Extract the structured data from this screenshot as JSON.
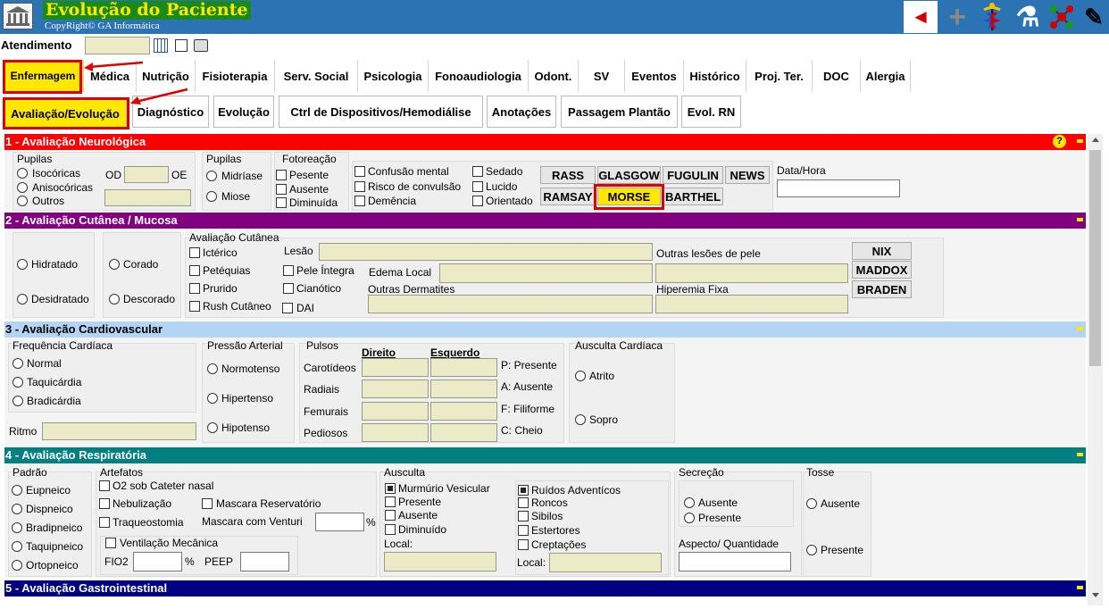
{
  "app": {
    "title": "Evolução do Paciente",
    "copyright": "CopyRight© GA Informática"
  },
  "toolbar": {
    "icons": [
      "back-arrow-icon",
      "plus-icon",
      "caduceus-icon",
      "lab-flask-icon",
      "molecule-icon",
      "pen-tools-icon"
    ],
    "back_glyph": "◄",
    "plus_glyph": "+",
    "flask_glyph": "⚗",
    "molecule_glyph": "✣",
    "tools_glyph": "✎"
  },
  "atendimento": {
    "label": "Atendimento",
    "value": ""
  },
  "tabs": [
    "Enfermagem",
    "Médica",
    "Nutrição",
    "Fisioterapia",
    "Serv. Social",
    "Psicologia",
    "Fonoaudiologia",
    "Odont.",
    "SV",
    "Eventos",
    "Histórico",
    "Proj. Ter.",
    "DOC",
    "Alergia"
  ],
  "subtabs": [
    "Avaliação/Evolução",
    "Diagnóstico",
    "Evolução",
    "Ctrl de Dispositivos/Hemodiálise",
    "Anotações",
    "Passagem Plantão",
    "Evol. RN"
  ],
  "colors": {
    "header": "#2b73b3",
    "sec1": "#ff0000",
    "sec2": "#800080",
    "sec3": "#b3d4f3",
    "sec4": "#008080",
    "sec5": "#000080",
    "field": "#ecebc8",
    "highlight": "#ffe800"
  },
  "s1": {
    "title": "1 - Avaliação Neurológica",
    "help": "?",
    "pupilas_a": "Pupilas",
    "isocoricas": "Isocóricas",
    "anisocoricas": "Anisocóricas",
    "outros": "Outros",
    "od": "OD",
    "oe": "OE",
    "pupilas_b": "Pupilas",
    "midriase": "Midríase",
    "miose": "Miose",
    "fotoreacao": "Fotoreação",
    "presente": "Pesente",
    "ausente": "Ausente",
    "diminuida": "Diminuída",
    "confusao": "Confusão mental",
    "risco": "Risco de convulsão",
    "demencia": "Demência",
    "sedado": "Sedado",
    "lucido": "Lucido",
    "orientado": "Orientado",
    "scales": [
      "RASS",
      "GLASGOW",
      "FUGULIN",
      "NEWS",
      "RAMSAY",
      "MORSE",
      "BARTHEL"
    ],
    "datahora": "Data/Hora"
  },
  "s2": {
    "title": "2 - Avaliação Cutânea / Mucosa",
    "hidratado": "Hidratado",
    "desidratado": "Desidratado",
    "corado": "Corado",
    "descorado": "Descorado",
    "aval": "Avaliação Cutânea",
    "icterico": "Ictérico",
    "peteq": "Petéquias",
    "prurido": "Prurido",
    "rush": "Rush Cutâneo",
    "pele": "Pele Íntegra",
    "cian": "Cianótico",
    "dai": "DAI",
    "lesao": "Lesão",
    "edema": "Edema Local",
    "outras_derm": "Outras Dermatites",
    "outras_lesoes": "Outras lesões de pele",
    "hiperemia": "Hiperemia Fixa",
    "scales": [
      "NIX",
      "MADDOX",
      "BRADEN"
    ]
  },
  "s3": {
    "title": "3 - Avaliação Cardiovascular",
    "freq": "Frequência Cardíaca",
    "normal": "Normal",
    "taqui": "Taquicárdia",
    "bradi": "Bradicárdia",
    "ritmo": "Ritmo",
    "pressao": "Pressão Arterial",
    "normo": "Normotenso",
    "hiper": "Hipertenso",
    "hipo": "Hipotenso",
    "pulsos": "Pulsos",
    "direito": "Direito",
    "esquerdo": "Esquerdo",
    "rows": [
      "Carotídeos",
      "Radiais",
      "Femurais",
      "Pediosos"
    ],
    "legend": [
      "P: Presente",
      "A: Ausente",
      "F: Filiforme",
      "C: Cheio"
    ],
    "ausculta": "Ausculta Cardíaca",
    "atrito": "Atrito",
    "sopro": "Sopro"
  },
  "s4": {
    "title": "4 - Avaliação Respiratória",
    "padrao": "Padrão",
    "pad": [
      "Eupneico",
      "Dispneico",
      "Bradipneico",
      "Taquipneico",
      "Ortopneico"
    ],
    "artefatos": "Artefatos",
    "o2": "O2 sob Cateter nasal",
    "nebu": "Nebulização",
    "traq": "Traqueostomia",
    "mascres": "Mascara Reservatório",
    "mascvent": "Mascara com Venturi",
    "pct": "%",
    "vent": "Ventilação Mecânica",
    "fio2": "FIO2",
    "peep": "PEEP",
    "ausculta": "Ausculta",
    "murm": "Murmúrio Vesicular",
    "presente": "Presente",
    "ausente": "Ausente",
    "diminuido": "Diminuído",
    "local": "Local:",
    "ruidos": "Ruídos Adventícos",
    "roncos": "Roncos",
    "sibilos": "Sibilos",
    "estertores": "Estertores",
    "crep": "Creptações",
    "secrecao": "Secreção",
    "sec_aus": "Ausente",
    "sec_pres": "Presente",
    "aspecto": "Aspecto/ Quantidade",
    "tosse": "Tosse",
    "tos_aus": "Ausente",
    "tos_pres": "Presente"
  },
  "s5": {
    "title": "5 - Avaliação Gastrointestinal"
  }
}
